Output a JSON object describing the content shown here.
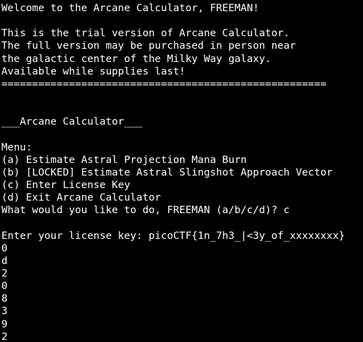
{
  "terminal": {
    "welcome": "Welcome to the Arcane Calculator, FREEMAN!",
    "trial_1": "This is the trial version of Arcane Calculator.",
    "trial_2": "The full version may be purchased in person near",
    "trial_3": "the galactic center of the Milky Way galaxy.",
    "trial_4": "Available while supplies last!",
    "separator": "=====================================================",
    "heading": "___Arcane Calculator___",
    "menu_title": "Menu:",
    "menu_a": "(a) Estimate Astral Projection Mana Burn",
    "menu_b": "(b) [LOCKED] Estimate Astral Slingshot Approach Vector",
    "menu_c": "(c) Enter License Key",
    "menu_d": "(d) Exit Arcane Calculator",
    "prompt": "What would you like to do, FREEMAN (a/b/c/d)? c",
    "license_prompt": "Enter your license key: picoCTF{1n_7h3_|<3y_of_xxxxxxxx}",
    "output_chars": [
      "0",
      "d",
      "2",
      "0",
      "8",
      "3",
      "9",
      "2"
    ],
    "colors": {
      "background": "#000000",
      "foreground": "#ffffff"
    }
  }
}
